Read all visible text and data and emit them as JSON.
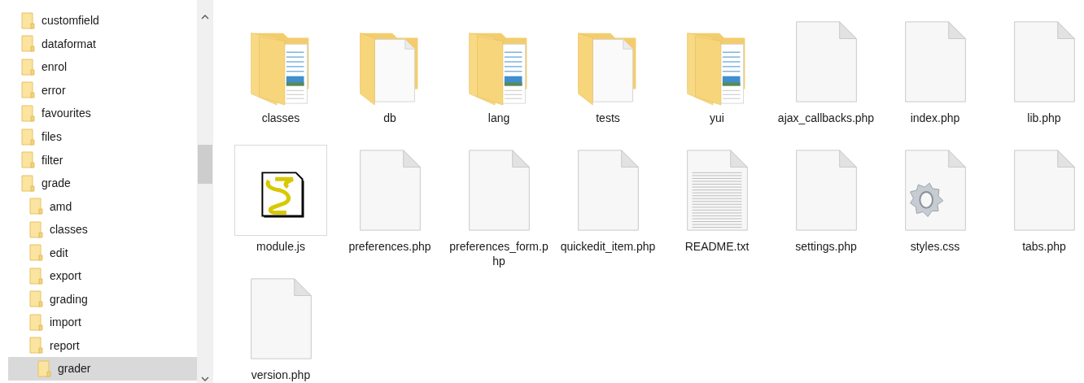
{
  "tree": [
    {
      "label": "customfield",
      "selected": false
    },
    {
      "label": "dataformat",
      "selected": false
    },
    {
      "label": "enrol",
      "selected": false
    },
    {
      "label": "error",
      "selected": false
    },
    {
      "label": "favourites",
      "selected": false
    },
    {
      "label": "files",
      "selected": false
    },
    {
      "label": "filter",
      "selected": false
    },
    {
      "label": "grade",
      "selected": false,
      "children": [
        {
          "label": "amd",
          "selected": false
        },
        {
          "label": "classes",
          "selected": false
        },
        {
          "label": "edit",
          "selected": false
        },
        {
          "label": "export",
          "selected": false
        },
        {
          "label": "grading",
          "selected": false
        },
        {
          "label": "import",
          "selected": false
        },
        {
          "label": "report",
          "selected": false,
          "children": [
            {
              "label": "grader",
              "selected": true
            }
          ]
        }
      ]
    }
  ],
  "files": [
    {
      "name": "classes",
      "kind": "folder-docs",
      "selected": false
    },
    {
      "name": "db",
      "kind": "folder-page",
      "selected": false
    },
    {
      "name": "lang",
      "kind": "folder-docs",
      "selected": false
    },
    {
      "name": "tests",
      "kind": "folder-page",
      "selected": false
    },
    {
      "name": "yui",
      "kind": "folder-docs",
      "selected": false
    },
    {
      "name": "ajax_callbacks.php",
      "kind": "file",
      "selected": false
    },
    {
      "name": "index.php",
      "kind": "file",
      "selected": false
    },
    {
      "name": "lib.php",
      "kind": "file",
      "selected": false
    },
    {
      "name": "module.js",
      "kind": "script",
      "selected": true
    },
    {
      "name": "preferences.php",
      "kind": "file",
      "selected": false
    },
    {
      "name": "preferences_form.php",
      "kind": "file",
      "selected": false
    },
    {
      "name": "quickedit_item.php",
      "kind": "file",
      "selected": false
    },
    {
      "name": "README.txt",
      "kind": "text",
      "selected": false
    },
    {
      "name": "settings.php",
      "kind": "file",
      "selected": false
    },
    {
      "name": "styles.css",
      "kind": "css",
      "selected": false
    },
    {
      "name": "tabs.php",
      "kind": "file",
      "selected": false
    },
    {
      "name": "version.php",
      "kind": "file",
      "selected": false
    }
  ]
}
